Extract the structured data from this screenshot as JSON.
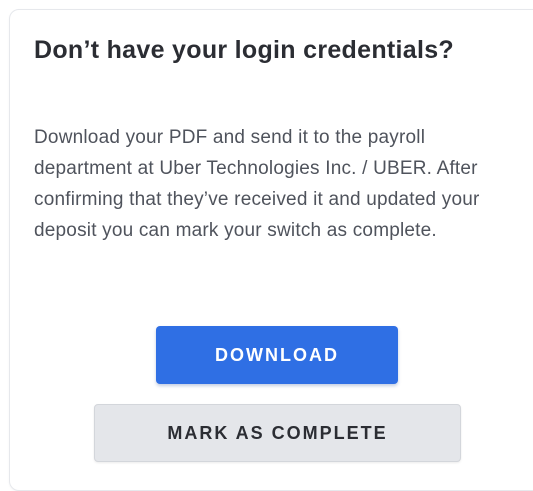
{
  "card": {
    "title": "Don’t have your login credentials?",
    "description": "Download your PDF and send it to the payroll department at Uber Technologies Inc. / UBER. After confirming that they’ve received it and updated your deposit you can mark your switch as complete."
  },
  "actions": {
    "download_label": "DOWNLOAD",
    "mark_complete_label": "MARK AS COMPLETE"
  },
  "colors": {
    "primary": "#2f6fe4",
    "secondary_bg": "#e4e6ea",
    "title_text": "#2b2d33",
    "body_text": "#4f535c"
  }
}
